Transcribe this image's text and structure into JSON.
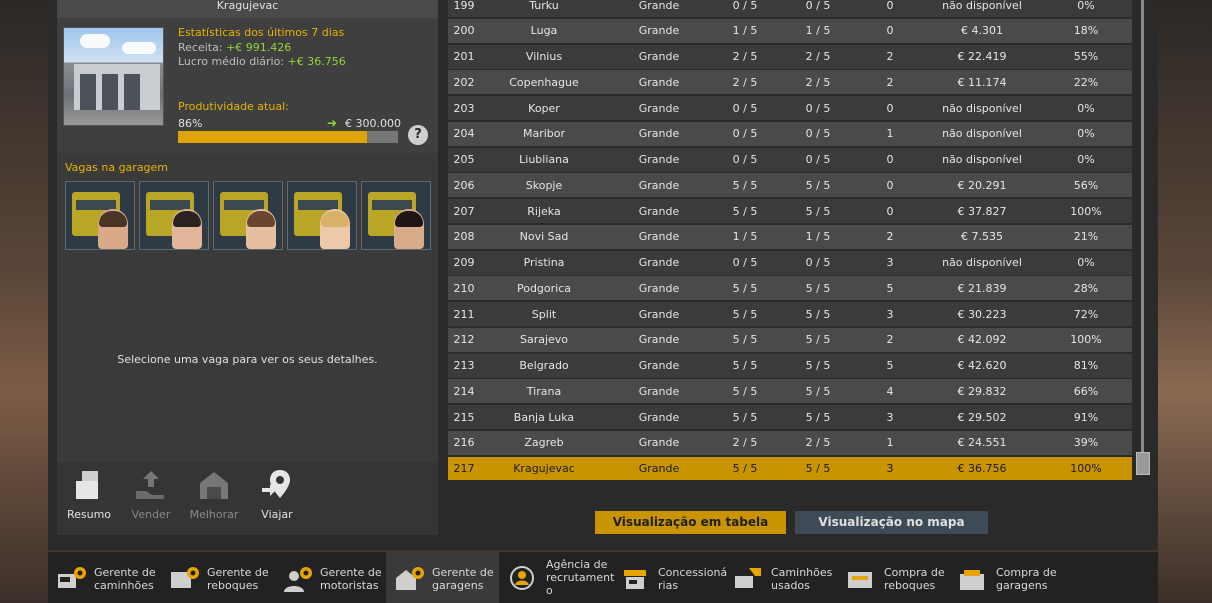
{
  "garage": {
    "name": "Kragujevac",
    "stats_title": "Estatísticas dos últimos 7 dias",
    "revenue_label": "Receita:",
    "revenue_value": "+€ 991.426",
    "daily_profit_label": "Lucro médio diário:",
    "daily_profit_value": "+€ 36.756",
    "productivity_title": "Produtividade atual:",
    "productivity_pct": "86%",
    "productivity_fraction": 0.86,
    "productivity_target": "€ 300.000",
    "help_label": "?"
  },
  "slots": {
    "title": "Vagas na garagem",
    "select_message": "Selecione uma vaga para ver os seus detalhes."
  },
  "actions": [
    {
      "label": "Resumo",
      "enabled": true
    },
    {
      "label": "Vender",
      "enabled": false
    },
    {
      "label": "Melhorar",
      "enabled": false
    },
    {
      "label": "Viajar",
      "enabled": true
    }
  ],
  "table": {
    "rows": [
      {
        "id": "199",
        "city": "Turku",
        "size": "Grande",
        "trucks": "0 / 5",
        "drivers": "0 / 5",
        "trailers": "0",
        "profit": "não disponível",
        "prod": "0%"
      },
      {
        "id": "200",
        "city": "Luga",
        "size": "Grande",
        "trucks": "1 / 5",
        "drivers": "1 / 5",
        "trailers": "0",
        "profit": "€ 4.301",
        "prod": "18%"
      },
      {
        "id": "201",
        "city": "Vilnius",
        "size": "Grande",
        "trucks": "2 / 5",
        "drivers": "2 / 5",
        "trailers": "2",
        "profit": "€ 22.419",
        "prod": "55%"
      },
      {
        "id": "202",
        "city": "Copenhague",
        "size": "Grande",
        "trucks": "2 / 5",
        "drivers": "2 / 5",
        "trailers": "2",
        "profit": "€ 11.174",
        "prod": "22%"
      },
      {
        "id": "203",
        "city": "Koper",
        "size": "Grande",
        "trucks": "0 / 5",
        "drivers": "0 / 5",
        "trailers": "0",
        "profit": "não disponível",
        "prod": "0%"
      },
      {
        "id": "204",
        "city": "Maribor",
        "size": "Grande",
        "trucks": "0 / 5",
        "drivers": "0 / 5",
        "trailers": "1",
        "profit": "não disponível",
        "prod": "0%"
      },
      {
        "id": "205",
        "city": "Liubliana",
        "size": "Grande",
        "trucks": "0 / 5",
        "drivers": "0 / 5",
        "trailers": "0",
        "profit": "não disponível",
        "prod": "0%"
      },
      {
        "id": "206",
        "city": "Skopje",
        "size": "Grande",
        "trucks": "5 / 5",
        "drivers": "5 / 5",
        "trailers": "0",
        "profit": "€ 20.291",
        "prod": "56%"
      },
      {
        "id": "207",
        "city": "Rijeka",
        "size": "Grande",
        "trucks": "5 / 5",
        "drivers": "5 / 5",
        "trailers": "0",
        "profit": "€ 37.827",
        "prod": "100%"
      },
      {
        "id": "208",
        "city": "Novi Sad",
        "size": "Grande",
        "trucks": "1 / 5",
        "drivers": "1 / 5",
        "trailers": "2",
        "profit": "€ 7.535",
        "prod": "21%"
      },
      {
        "id": "209",
        "city": "Pristina",
        "size": "Grande",
        "trucks": "0 / 5",
        "drivers": "0 / 5",
        "trailers": "3",
        "profit": "não disponível",
        "prod": "0%"
      },
      {
        "id": "210",
        "city": "Podgorica",
        "size": "Grande",
        "trucks": "5 / 5",
        "drivers": "5 / 5",
        "trailers": "5",
        "profit": "€ 21.839",
        "prod": "28%"
      },
      {
        "id": "211",
        "city": "Split",
        "size": "Grande",
        "trucks": "5 / 5",
        "drivers": "5 / 5",
        "trailers": "3",
        "profit": "€ 30.223",
        "prod": "72%"
      },
      {
        "id": "212",
        "city": "Sarajevo",
        "size": "Grande",
        "trucks": "5 / 5",
        "drivers": "5 / 5",
        "trailers": "2",
        "profit": "€ 42.092",
        "prod": "100%"
      },
      {
        "id": "213",
        "city": "Belgrado",
        "size": "Grande",
        "trucks": "5 / 5",
        "drivers": "5 / 5",
        "trailers": "5",
        "profit": "€ 42.620",
        "prod": "81%"
      },
      {
        "id": "214",
        "city": "Tirana",
        "size": "Grande",
        "trucks": "5 / 5",
        "drivers": "5 / 5",
        "trailers": "4",
        "profit": "€ 29.832",
        "prod": "66%"
      },
      {
        "id": "215",
        "city": "Banja Luka",
        "size": "Grande",
        "trucks": "5 / 5",
        "drivers": "5 / 5",
        "trailers": "3",
        "profit": "€ 29.502",
        "prod": "91%"
      },
      {
        "id": "216",
        "city": "Zagreb",
        "size": "Grande",
        "trucks": "2 / 5",
        "drivers": "2 / 5",
        "trailers": "1",
        "profit": "€ 24.551",
        "prod": "39%"
      },
      {
        "id": "217",
        "city": "Kragujevac",
        "size": "Grande",
        "trucks": "5 / 5",
        "drivers": "5 / 5",
        "trailers": "3",
        "profit": "€ 36.756",
        "prod": "100%",
        "selected": true
      }
    ]
  },
  "view_toggle": {
    "table_label": "Visualização em tabela",
    "map_label": "Visualização no mapa",
    "active": "table"
  },
  "bottom_nav": [
    {
      "label": "Gerente de caminhões",
      "icon": "truck-gear-icon"
    },
    {
      "label": "Gerente de reboques",
      "icon": "trailer-gear-icon"
    },
    {
      "label": "Gerente de motoristas",
      "icon": "driver-gear-icon"
    },
    {
      "label": "Gerente de garagens",
      "icon": "garage-gear-icon",
      "active": true
    },
    {
      "label": "Agência de recrutament o",
      "icon": "recruitment-icon"
    },
    {
      "label": "Concessioná rias",
      "icon": "dealership-icon"
    },
    {
      "label": "Caminhões usados",
      "icon": "used-truck-icon"
    },
    {
      "label": "Compra de reboques",
      "icon": "buy-trailer-icon"
    },
    {
      "label": "Compra de garagens",
      "icon": "buy-garage-icon"
    }
  ],
  "colors": {
    "accent": "#c99400",
    "positive": "#8fd63a",
    "heading": "#e8b400"
  }
}
